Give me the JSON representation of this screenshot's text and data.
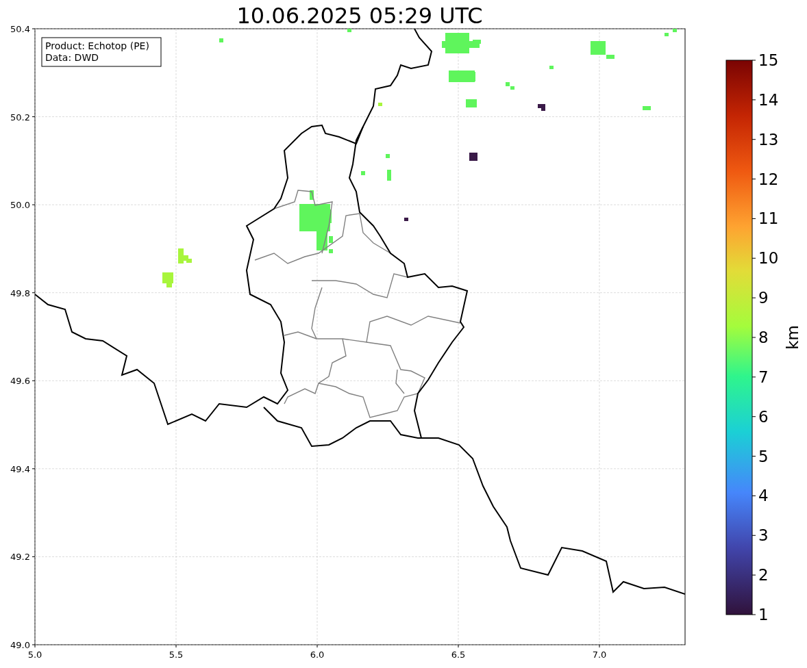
{
  "title": "10.06.2025 05:29 UTC",
  "legend": [
    "Product: Echotop (PE)",
    "Data: DWD"
  ],
  "x_ticks": [
    "5.0",
    "5.5",
    "6.0",
    "6.5",
    "7.0"
  ],
  "y_ticks": [
    "50.4",
    "50.2",
    "50.0",
    "49.8",
    "49.6",
    "49.4",
    "49.2",
    "49.0"
  ],
  "colorbar": {
    "label": "km",
    "ticks": [
      "15",
      "14",
      "13",
      "12",
      "11",
      "10",
      "9",
      "8",
      "7",
      "6",
      "5",
      "4",
      "3",
      "2",
      "1"
    ]
  }
}
